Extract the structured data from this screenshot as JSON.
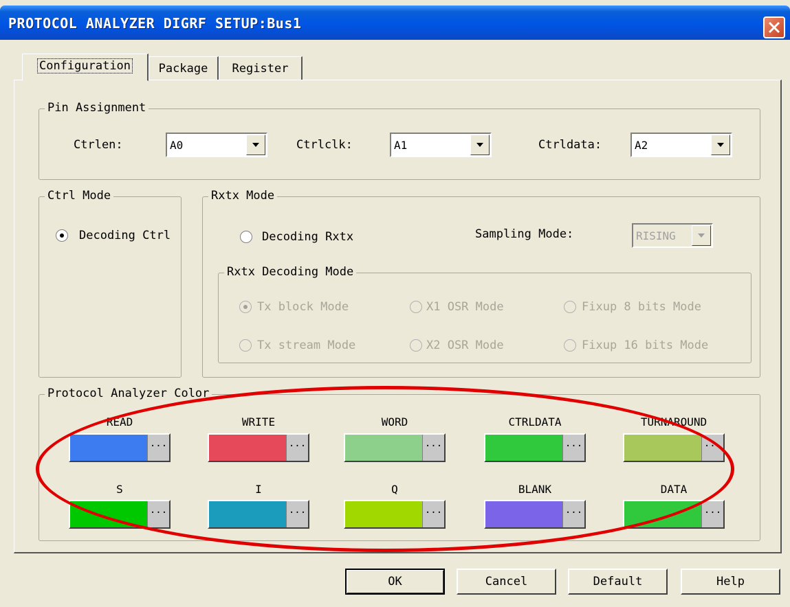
{
  "window": {
    "title": "PROTOCOL ANALYZER DIGRF SETUP:Bus1"
  },
  "tabs": [
    {
      "label": "Configuration",
      "active": true
    },
    {
      "label": "Package",
      "active": false
    },
    {
      "label": "Register",
      "active": false
    }
  ],
  "pin_assignment": {
    "title": "Pin Assignment",
    "ctrlen_label": "Ctrlen:",
    "ctrlen_value": "A0",
    "ctrlclk_label": "Ctrlclk:",
    "ctrlclk_value": "A1",
    "ctrldata_label": "Ctrldata:",
    "ctrldata_value": "A2"
  },
  "ctrl_mode": {
    "title": "Ctrl Mode",
    "option": "Decoding Ctrl",
    "checked": true
  },
  "rxtx_mode": {
    "title": "Rxtx Mode",
    "option": "Decoding Rxtx",
    "sampling_label": "Sampling Mode:",
    "sampling_value": "RISING",
    "decoding": {
      "title": "Rxtx Decoding Mode",
      "options": [
        {
          "label": "Tx block Mode",
          "checked": true
        },
        {
          "label": "X1 OSR Mode",
          "checked": false
        },
        {
          "label": "Fixup 8 bits Mode",
          "checked": false
        },
        {
          "label": "Tx stream Mode",
          "checked": false
        },
        {
          "label": "X2 OSR Mode",
          "checked": false
        },
        {
          "label": "Fixup 16 bits Mode",
          "checked": false
        }
      ]
    }
  },
  "colors": {
    "title": "Protocol Analyzer Color",
    "dots": "...",
    "items": [
      {
        "label": "READ",
        "color": "#3c7cf0"
      },
      {
        "label": "WRITE",
        "color": "#e64a5a"
      },
      {
        "label": "WORD",
        "color": "#8cd08c"
      },
      {
        "label": "CTRLDATA",
        "color": "#30c83c"
      },
      {
        "label": "TURNAROUND",
        "color": "#a8c85c"
      },
      {
        "label": "S",
        "color": "#00c800"
      },
      {
        "label": "I",
        "color": "#1c9cbc"
      },
      {
        "label": "Q",
        "color": "#a0d800"
      },
      {
        "label": "BLANK",
        "color": "#7c64e8"
      },
      {
        "label": "DATA",
        "color": "#30c83c"
      }
    ]
  },
  "buttons": {
    "ok": "OK",
    "cancel": "Cancel",
    "default": "Default",
    "help": "Help"
  },
  "annotation_color": "#e00000"
}
